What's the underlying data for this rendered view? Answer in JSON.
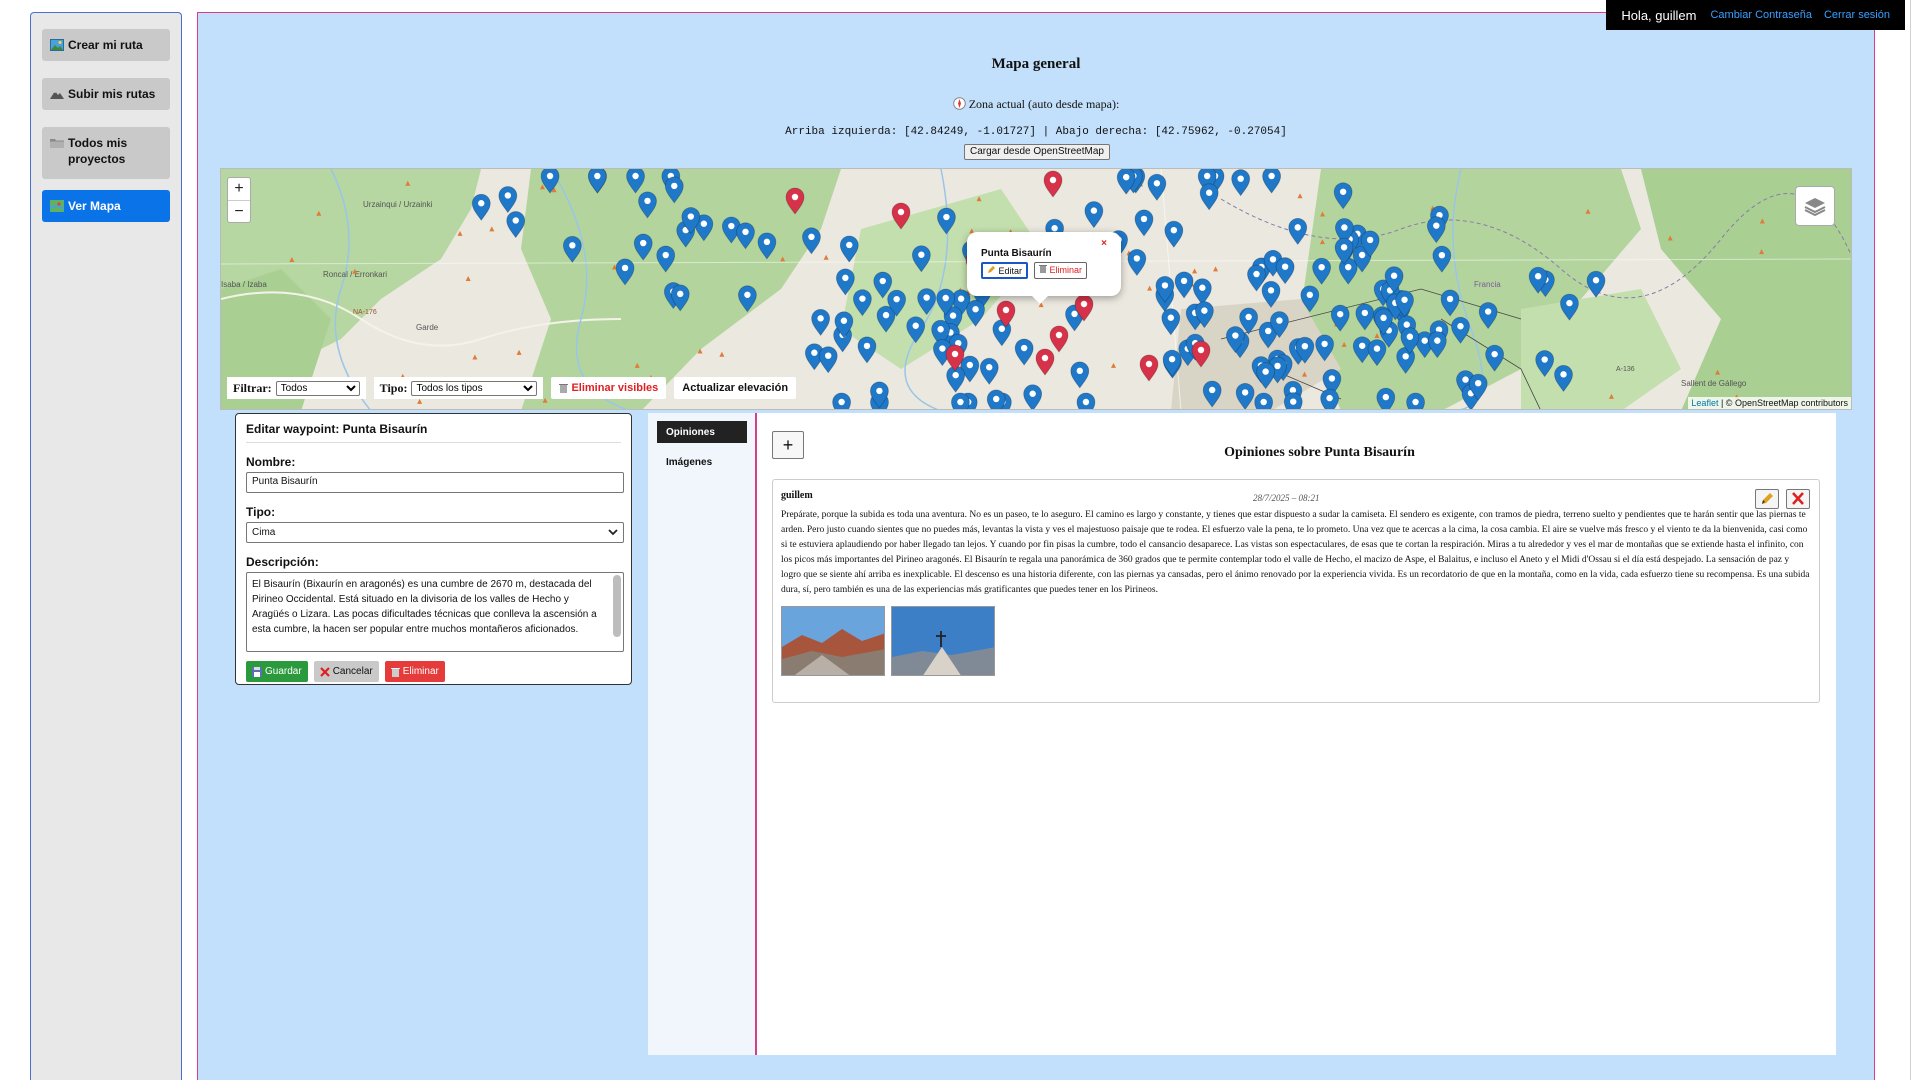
{
  "sidebar": {
    "items": [
      {
        "label": "Crear mi ruta",
        "icon": "image-icon",
        "active": false
      },
      {
        "label": "Subir mis rutas",
        "icon": "mountain-icon",
        "active": false
      },
      {
        "label": "Todos mis proyectos",
        "icon": "folder-icon",
        "active": false
      },
      {
        "label": "Ver Mapa",
        "icon": "map-icon",
        "active": true
      }
    ]
  },
  "topbar": {
    "greeting": "Hola, guillem",
    "change_password": "Cambiar Contraseña",
    "logout": "Cerrar sesión"
  },
  "header": {
    "title": "Mapa general",
    "zone_label": "Zona actual (auto desde mapa):",
    "coords": "Arriba izquierda: [42.84249, -1.01727] | Abajo derecha: [42.75962, -0.27054]",
    "load_button": "Cargar desde OpenStreetMap"
  },
  "map": {
    "zoom_in": "+",
    "zoom_out": "−",
    "filter_label": "Filtrar:",
    "filter_value": "Todos",
    "type_label": "Tipo:",
    "type_value": "Todos los tipos",
    "delete_visible": "Eliminar visibles",
    "update_elevation": "Actualizar elevación",
    "attribution_leaflet": "Leaflet",
    "attribution_osm": "| © OpenStreetMap contributors",
    "place_labels": [
      "Urzainqui / Urzainki",
      "Roncal / Erronkari",
      "Garde",
      "NA-176",
      "Isaba / Izaba",
      "A-136",
      "Sallent de Gállego",
      "Francia"
    ],
    "popup": {
      "name": "Punta Bisaurín",
      "close": "×",
      "edit": "Editar",
      "delete": "Eliminar"
    },
    "colors": {
      "marker_blue": "#1f78c8",
      "marker_red": "#d6334a"
    }
  },
  "edit_form": {
    "title": "Editar waypoint: Punta Bisaurín",
    "name_label": "Nombre:",
    "name_value": "Punta Bisaurín",
    "type_label": "Tipo:",
    "type_value": "Cima",
    "desc_label": "Descripción:",
    "desc_value": "El Bisaurín (Bixaurín en aragonés) es una cumbre de 2670 m, destacada del Pirineo Occidental. Está situado en la divisoria de los valles de Hecho y Aragüés o Lizara. Las pocas dificultades técnicas que conlleva la ascensión a esta cumbre, la hacen ser popular entre muchos montañeros aficionados.",
    "save": "Guardar",
    "cancel": "Cancelar",
    "delete": "Eliminar"
  },
  "opinions": {
    "tabs": [
      "Opiniones",
      "Imágenes"
    ],
    "add_button": "+",
    "title": "Opiniones sobre Punta Bisaurín",
    "entry": {
      "user": "guillem",
      "date": "28/7/2025 – 08:21",
      "text": "Prepárate, porque la subida es toda una aventura. No es un paseo, te lo aseguro. El camino es largo y constante, y tienes que estar dispuesto a sudar la camiseta. El sendero es exigente, con tramos de piedra, terreno suelto y pendientes que te harán sentir que las piernas te arden. Pero justo cuando sientes que no puedes más, levantas la vista y ves el majestuoso paisaje que te rodea. El esfuerzo vale la pena, te lo prometo. Una vez que te acercas a la cima, la cosa cambia. El aire se vuelve más fresco y el viento te da la bienvenida, casi como si te estuviera aplaudiendo por haber llegado tan lejos. Y cuando por fin pisas la cumbre, todo el cansancio desaparece. Las vistas son espectaculares, de esas que te cortan la respiración. Miras a tu alrededor y ves el mar de montañas que se extiende hasta el infinito, con los picos más importantes del Pirineo aragonés. El Bisaurín te regala una panorámica de 360 grados que te permite contemplar todo el valle de Hecho, el macizo de Aspe, el Balaitus, e incluso el Aneto y el Midi d'Ossau si el día está despejado. La sensación de paz y logro que se siente ahí arriba es inexplicable. El descenso es una historia diferente, con las piernas ya cansadas, pero el ánimo renovado por la experiencia vivida. Es un recordatorio de que en la montaña, como en la vida, cada esfuerzo tiene su recompensa. Es una subida dura, sí, pero también es una de las experiencias más gratificantes que puedes tener en los Pirineos."
    }
  }
}
